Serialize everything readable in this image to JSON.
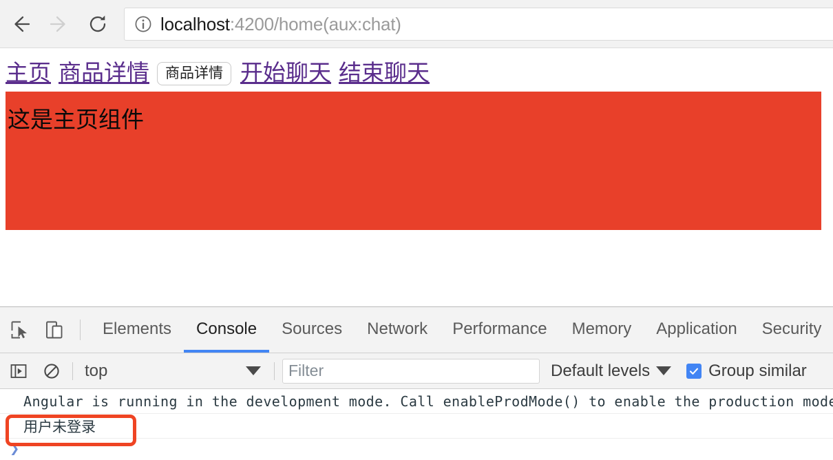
{
  "browser": {
    "back_icon": "arrow-left-icon",
    "forward_icon": "arrow-right-icon",
    "reload_icon": "reload-icon",
    "page_info_icon": "info-circle-icon",
    "url_host": "localhost",
    "url_rest": ":4200/home(aux:chat)",
    "url_full": "localhost:4200/home(aux:chat)"
  },
  "page": {
    "nav_links": [
      {
        "label": "主页"
      },
      {
        "label": "商品详情"
      },
      {
        "label": "开始聊天"
      },
      {
        "label": "结束聊天"
      }
    ],
    "product_detail_button": "商品详情",
    "banner_text": "这是主页组件",
    "banner_color": "#e8402a",
    "link_color": "#5a2d8c"
  },
  "devtools": {
    "inspect_icon": "inspect-cursor-icon",
    "device_toolbar_icon": "device-toolbar-icon",
    "tabs": [
      {
        "label": "Elements",
        "active": false
      },
      {
        "label": "Console",
        "active": true
      },
      {
        "label": "Sources",
        "active": false
      },
      {
        "label": "Network",
        "active": false
      },
      {
        "label": "Performance",
        "active": false
      },
      {
        "label": "Memory",
        "active": false
      },
      {
        "label": "Application",
        "active": false
      },
      {
        "label": "Security",
        "active": false
      }
    ],
    "active_tab": "Console",
    "active_tab_color": "#4285f4",
    "console_toolbar": {
      "sidebar_icon": "console-sidebar-icon",
      "clear_icon": "clear-console-icon",
      "context": "top",
      "filter_placeholder": "Filter",
      "filter_value": "",
      "log_levels": "Default levels",
      "group_similar_label": "Group similar",
      "group_similar_checked": true,
      "checkbox_color": "#4285f4"
    },
    "messages": [
      {
        "text": "Angular is running in the development mode. Call enableProdMode() to enable the production mode."
      },
      {
        "text": "用户未登录"
      }
    ],
    "prompt_caret": "❯"
  },
  "annotation": {
    "highlight_color": "#ef4423",
    "target_text": "用户未登录"
  }
}
